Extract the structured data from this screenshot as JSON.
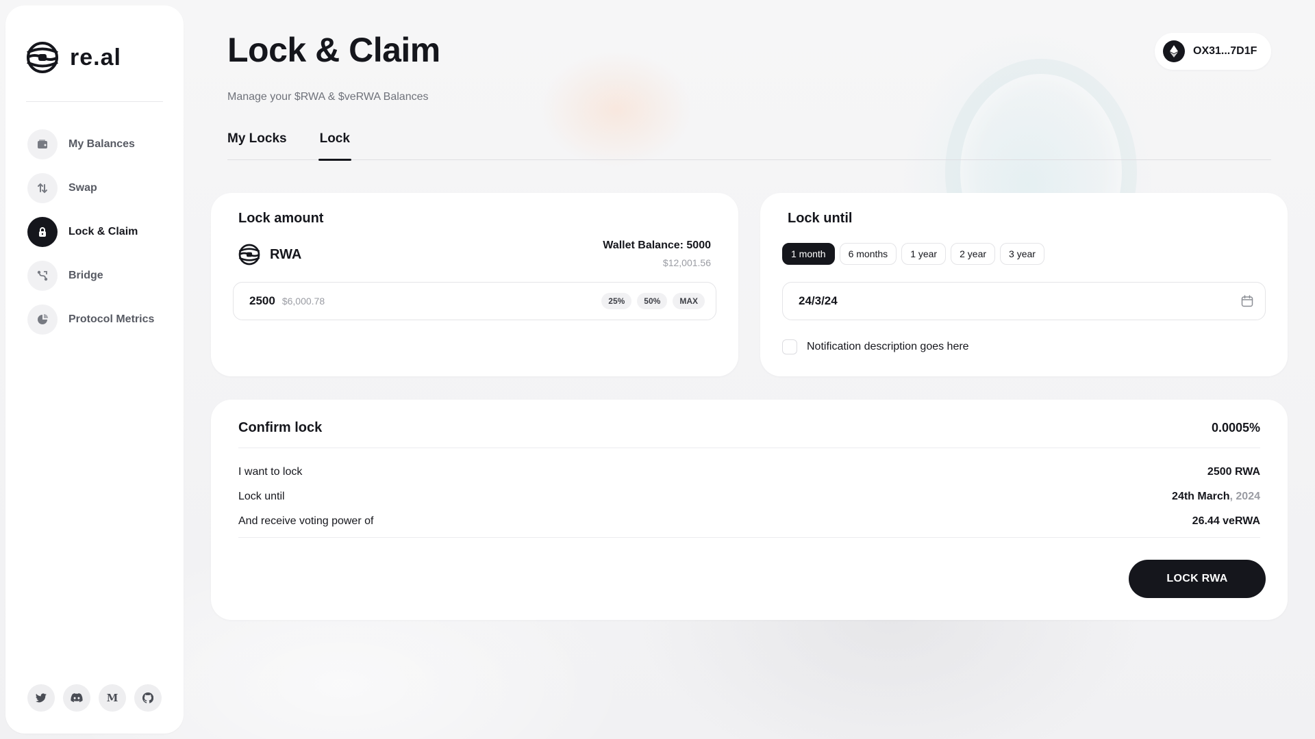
{
  "brand": {
    "name": "re.al"
  },
  "sidebar": {
    "items": [
      {
        "label": "My Balances",
        "icon": "wallet-icon",
        "active": false
      },
      {
        "label": "Swap",
        "icon": "swap-icon",
        "active": false
      },
      {
        "label": "Lock & Claim",
        "icon": "lock-icon",
        "active": true
      },
      {
        "label": "Bridge",
        "icon": "bridge-icon",
        "active": false
      },
      {
        "label": "Protocol Metrics",
        "icon": "pie-chart-icon",
        "active": false
      }
    ],
    "socials": [
      "twitter-icon",
      "discord-icon",
      "medium-icon",
      "github-icon"
    ]
  },
  "header": {
    "title": "Lock & Claim",
    "subtitle": "Manage your $RWA & $veRWA Balances",
    "wallet": {
      "address": "OX31...7D1F",
      "icon": "ethereum-icon"
    }
  },
  "tabs": [
    {
      "label": "My Locks",
      "active": false
    },
    {
      "label": "Lock",
      "active": true
    }
  ],
  "lock_amount": {
    "title": "Lock amount",
    "token": "RWA",
    "wallet_balance": "Wallet Balance: 5000",
    "wallet_balance_usd": "$12,001.56",
    "amount": "2500",
    "amount_usd": "$6,000.78",
    "presets": [
      "25%",
      "50%",
      "MAX"
    ]
  },
  "lock_until": {
    "title": "Lock until",
    "durations": [
      {
        "label": "1 month",
        "active": true
      },
      {
        "label": "6 months",
        "active": false
      },
      {
        "label": "1 year",
        "active": false
      },
      {
        "label": "2 year",
        "active": false
      },
      {
        "label": "3 year",
        "active": false
      }
    ],
    "date": "24/3/24",
    "notification": "Notification description goes here",
    "notification_checked": false
  },
  "confirm": {
    "title": "Confirm lock",
    "rate": "0.0005%",
    "rows": [
      {
        "label": "I want to lock",
        "value": "2500 RWA",
        "value_muted": ""
      },
      {
        "label": "Lock until",
        "value": "24th March",
        "value_muted": ", 2024"
      },
      {
        "label": "And receive voting power of",
        "value": "26.44 veRWA",
        "value_muted": ""
      }
    ],
    "button": "LOCK RWA"
  },
  "colors": {
    "primary": "#15161c",
    "background": "#f3f4f5",
    "card": "#ffffff",
    "muted": "#9a9ca3"
  }
}
